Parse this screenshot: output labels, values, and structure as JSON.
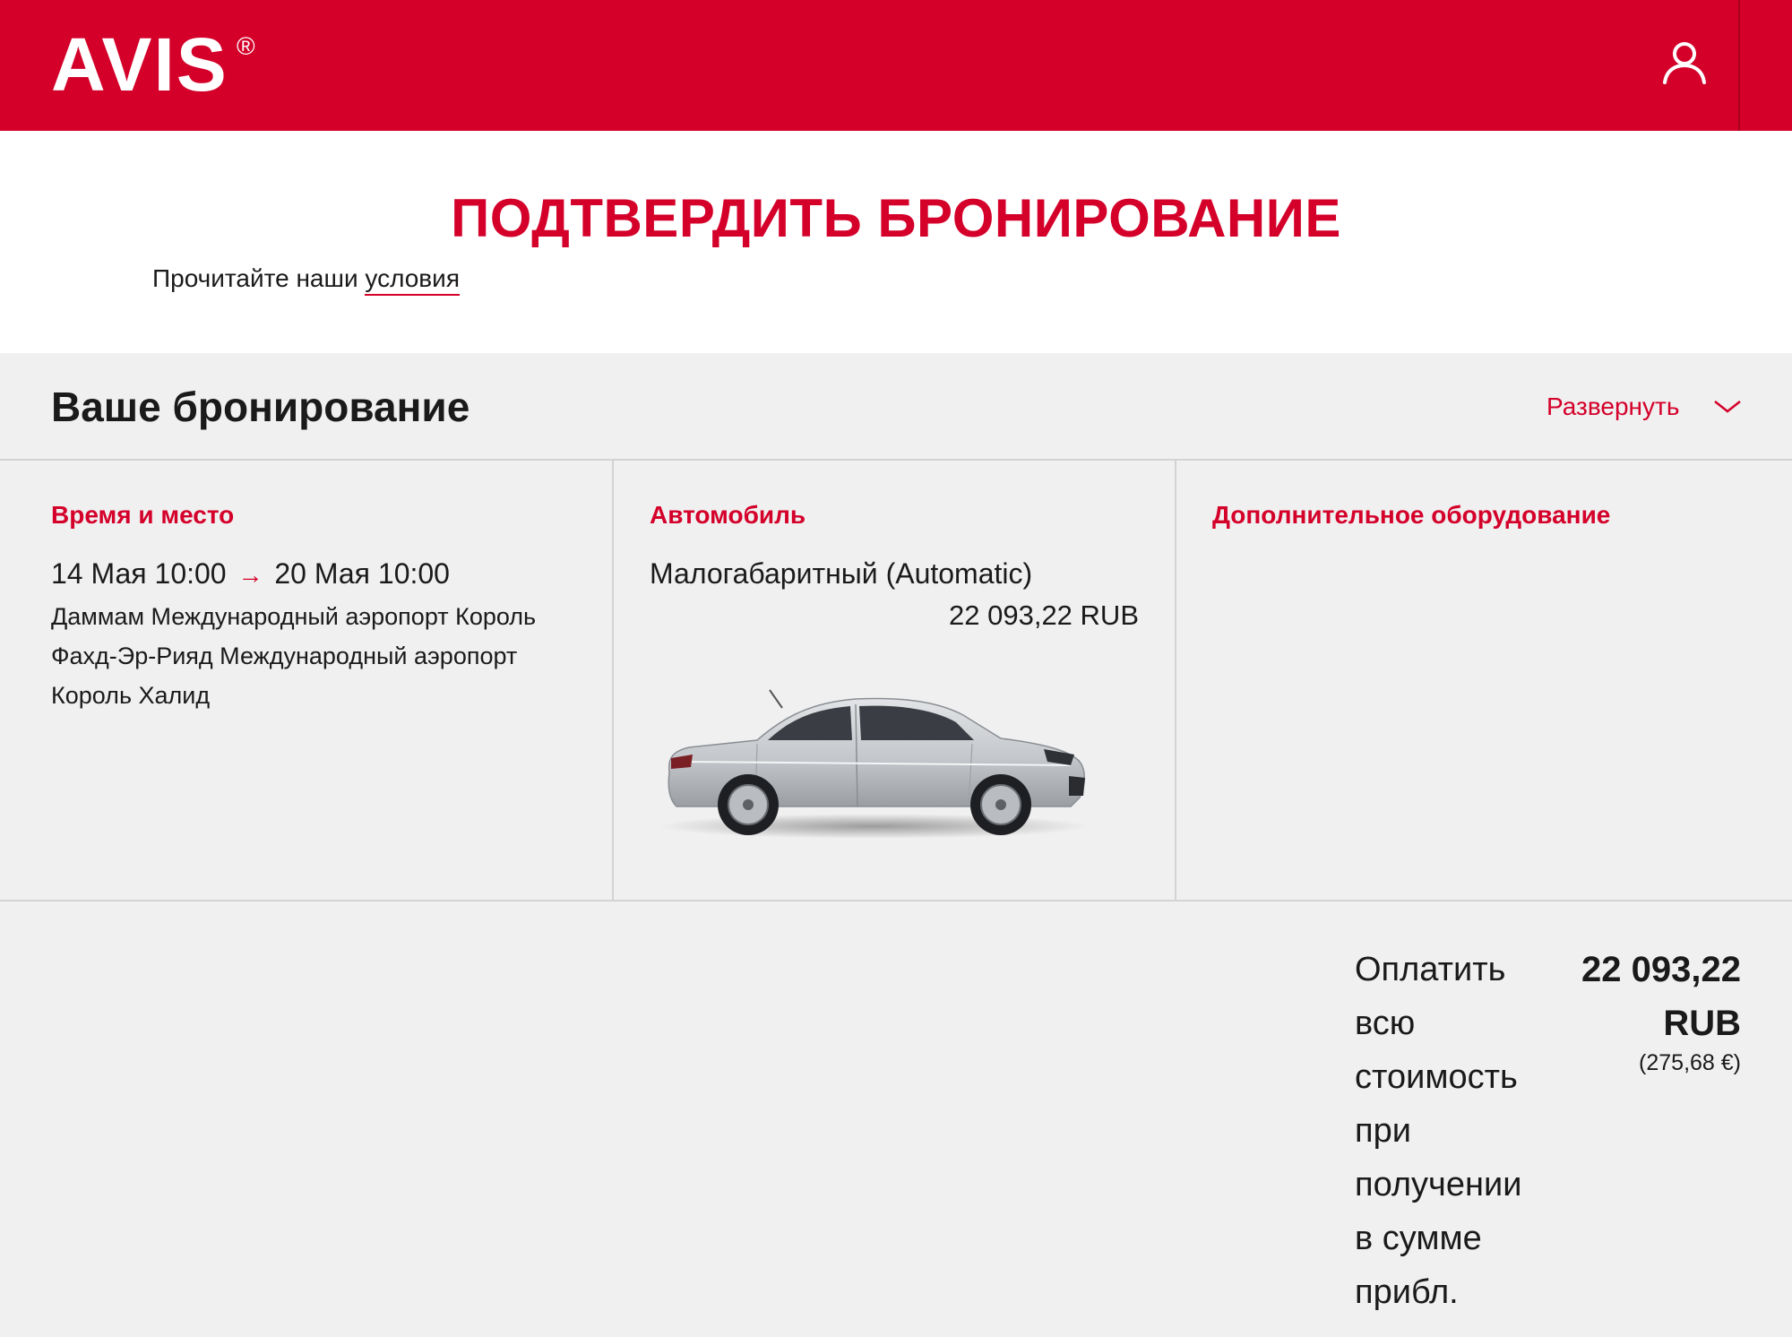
{
  "header": {
    "logo": "AVIS",
    "logo_mark": "®",
    "account_icon": "user-icon"
  },
  "hero": {
    "title": "ПОДТВЕРДИТЬ БРОНИРОВАНИЕ",
    "terms_prefix": "Прочитайте наши ",
    "terms_link": "условия"
  },
  "booking": {
    "title": "Ваше бронирование",
    "expand_label": "Развернуть",
    "expand_icon": "chevron-down-icon",
    "time_place": {
      "heading": "Время и место",
      "pickup": "14 Мая 10:00",
      "arrow": "→",
      "dropoff": "20 Мая 10:00",
      "location": "Даммам Международный аэропорт Король Фахд-Эр-Рияд Международный аэропорт Король Халид"
    },
    "vehicle": {
      "heading": "Автомобиль",
      "name": "Малогабаритный (Automatic)",
      "price": "22 093,22 RUB",
      "image": "silver-sedan-image"
    },
    "extras": {
      "heading": "Дополнительное оборудование"
    }
  },
  "total": {
    "label": "Оплатить всю стоимость при получении в сумме прибл.",
    "amount": "22 093,22 RUB",
    "amount_eur": "(275,68 €)"
  },
  "colors": {
    "brand_red": "#d4002a",
    "background": "#f0f0f0",
    "divider": "#d3d3d3"
  }
}
